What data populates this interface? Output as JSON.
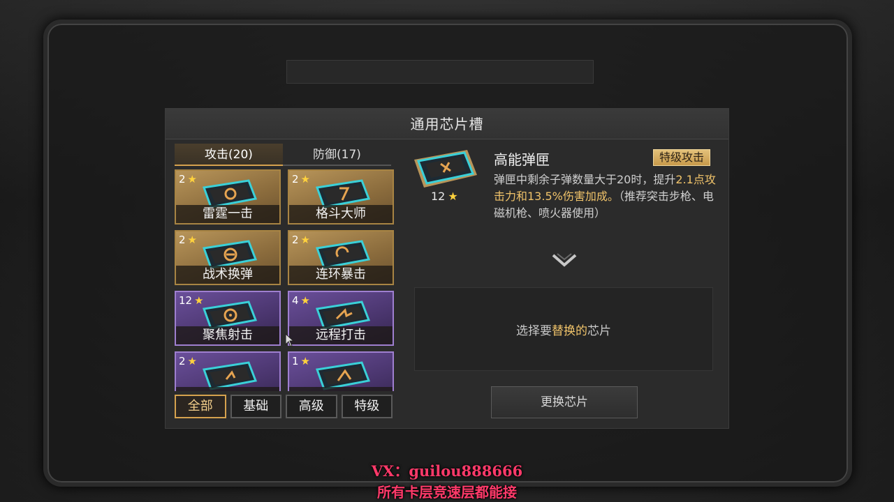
{
  "panel": {
    "title": "通用芯片槽"
  },
  "tabs": [
    {
      "label": "攻击(20)",
      "active": true
    },
    {
      "label": "防御(17)",
      "active": false
    }
  ],
  "chips": [
    {
      "level": "2",
      "name": "雷霆一击",
      "rarity": "gold"
    },
    {
      "level": "2",
      "name": "格斗大师",
      "rarity": "gold"
    },
    {
      "level": "2",
      "name": "战术换弹",
      "rarity": "gold"
    },
    {
      "level": "2",
      "name": "连环暴击",
      "rarity": "gold"
    },
    {
      "level": "12",
      "name": "聚焦射击",
      "rarity": "purple"
    },
    {
      "level": "4",
      "name": "远程打击",
      "rarity": "purple"
    },
    {
      "level": "2",
      "name": "",
      "rarity": "purple"
    },
    {
      "level": "1",
      "name": "",
      "rarity": "purple"
    }
  ],
  "filters": [
    {
      "label": "全部",
      "active": true
    },
    {
      "label": "基础",
      "active": false
    },
    {
      "label": "高级",
      "active": false
    },
    {
      "label": "特级",
      "active": false
    }
  ],
  "detail": {
    "level": "12",
    "name": "高能弹匣",
    "badge": "特级攻击",
    "desc_part1": "弹匣中剩余子弹数量大于20时，提升",
    "desc_hl": "2.1点攻击力和13.5%伤害加成。",
    "desc_part2": "（推荐突击步枪、电磁机枪、喷火器使用）"
  },
  "replace": {
    "hint_pre": "选择要",
    "hint_hl": "替换的",
    "hint_post": "芯片",
    "button_label": "更换芯片"
  },
  "watermark": {
    "line1": "VX：guilou888666",
    "line2": "所有卡层竞速层都能接"
  },
  "colors": {
    "accent_gold": "#d6a24e",
    "highlight_text": "#f0c36a",
    "star": "#ffd23d",
    "purple_rarity": "#6a4f9a",
    "gold_rarity": "#b8955a",
    "watermark": "#ff3a6a"
  }
}
